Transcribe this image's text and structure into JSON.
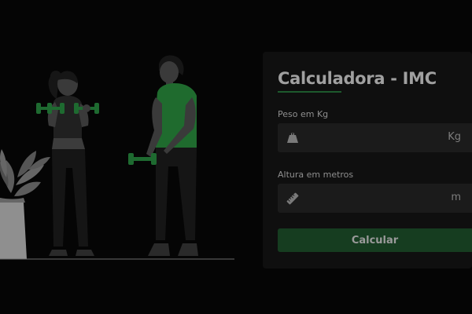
{
  "calculator": {
    "title": "Calculadora - IMC",
    "weight": {
      "label": "Peso em Kg",
      "unit": "Kg",
      "value": "",
      "placeholder": "",
      "icon": "weight-icon"
    },
    "height": {
      "label": "Altura em metros",
      "unit": "m",
      "value": "",
      "placeholder": "",
      "icon": "ruler-icon"
    },
    "button_label": "Calcular"
  },
  "colors": {
    "background": "#050505",
    "card": "#0f0f0f",
    "input": "#1b1b1b",
    "accent_green": "#1d5a2d",
    "button": "#163d20",
    "shirt_green": "#1f6b2e",
    "dumbbell_green": "#1e6a30"
  }
}
